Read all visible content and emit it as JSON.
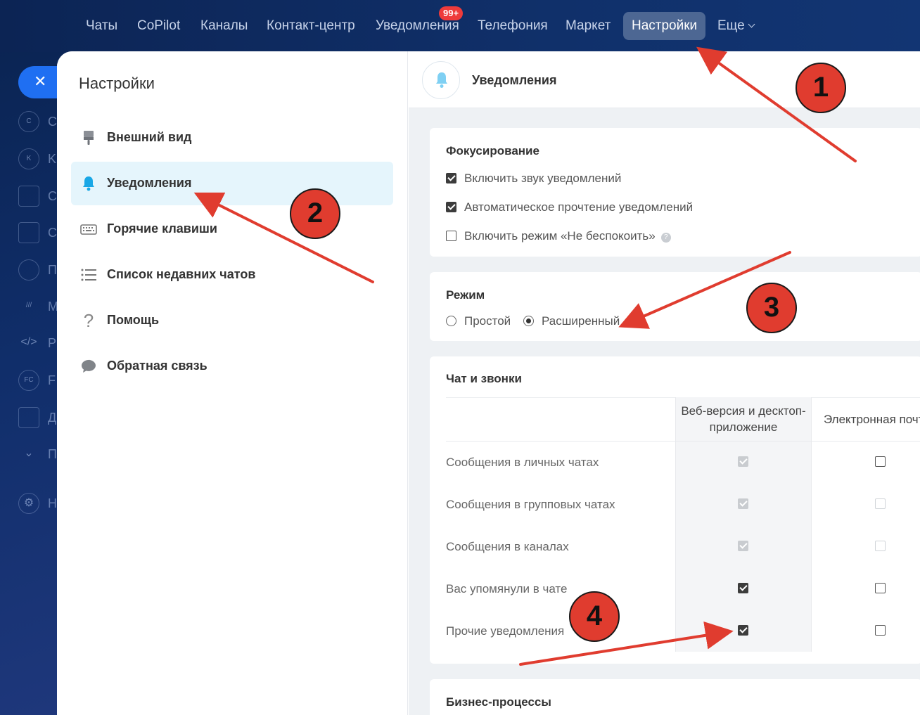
{
  "topnav": {
    "items": [
      {
        "label": "Чаты"
      },
      {
        "label": "CoPilot"
      },
      {
        "label": "Каналы"
      },
      {
        "label": "Контакт-центр"
      },
      {
        "label": "Уведомления",
        "badge": "99+"
      },
      {
        "label": "Телефония"
      },
      {
        "label": "Маркет"
      },
      {
        "label": "Настройки",
        "active": true
      },
      {
        "label": "Еще"
      }
    ]
  },
  "rail": {
    "close_icon": "close-icon",
    "badges": [
      "C",
      "K",
      "FC"
    ],
    "letters": [
      "C",
      "K",
      "C",
      "C",
      "П",
      "M",
      "P",
      "F",
      "Д",
      "П",
      "H"
    ]
  },
  "sidebar": {
    "title": "Настройки",
    "items": [
      {
        "label": "Внешний вид",
        "icon": "paintbrush-icon"
      },
      {
        "label": "Уведомления",
        "icon": "bell-icon",
        "active": true
      },
      {
        "label": "Горячие клавиши",
        "icon": "keyboard-icon"
      },
      {
        "label": "Список недавних чатов",
        "icon": "list-icon"
      },
      {
        "label": "Помощь",
        "icon": "question-icon",
        "glyph": "?"
      },
      {
        "label": "Обратная связь",
        "icon": "chat-bubble-icon"
      }
    ]
  },
  "content": {
    "header_title": "Уведомления",
    "focus": {
      "title": "Фокусирование",
      "options": [
        {
          "label": "Включить звук уведомлений",
          "checked": true
        },
        {
          "label": "Автоматическое прочтение уведомлений",
          "checked": true
        },
        {
          "label": "Включить режим «Не беспокоить»",
          "checked": false,
          "help": "?"
        }
      ]
    },
    "mode": {
      "title": "Режим",
      "options": [
        {
          "label": "Простой",
          "selected": false
        },
        {
          "label": "Расширенный",
          "selected": true
        }
      ]
    },
    "chat_calls": {
      "title": "Чат и звонки",
      "columns": [
        "Веб-версия и десктоп-приложение",
        "Электронная почта"
      ],
      "rows": [
        {
          "label": "Сообщения в личных чатах",
          "web": {
            "checked": true,
            "disabled": true
          },
          "email": {
            "checked": false,
            "disabled": false
          }
        },
        {
          "label": "Сообщения в групповых чатах",
          "web": {
            "checked": true,
            "disabled": true
          },
          "email": {
            "checked": false,
            "disabled": true
          }
        },
        {
          "label": "Сообщения в каналах",
          "web": {
            "checked": true,
            "disabled": true
          },
          "email": {
            "checked": false,
            "disabled": true
          }
        },
        {
          "label": "Вас упомянули в чате",
          "web": {
            "checked": true,
            "disabled": false
          },
          "email": {
            "checked": false,
            "disabled": false
          }
        },
        {
          "label": "Прочие уведомления",
          "web": {
            "checked": true,
            "disabled": false
          },
          "email": {
            "checked": false,
            "disabled": false
          }
        }
      ]
    },
    "business": {
      "title": "Бизнес-процессы"
    }
  },
  "annotations": {
    "labels": [
      "1",
      "2",
      "3",
      "4"
    ],
    "arrow_color": "#e03c2f"
  }
}
